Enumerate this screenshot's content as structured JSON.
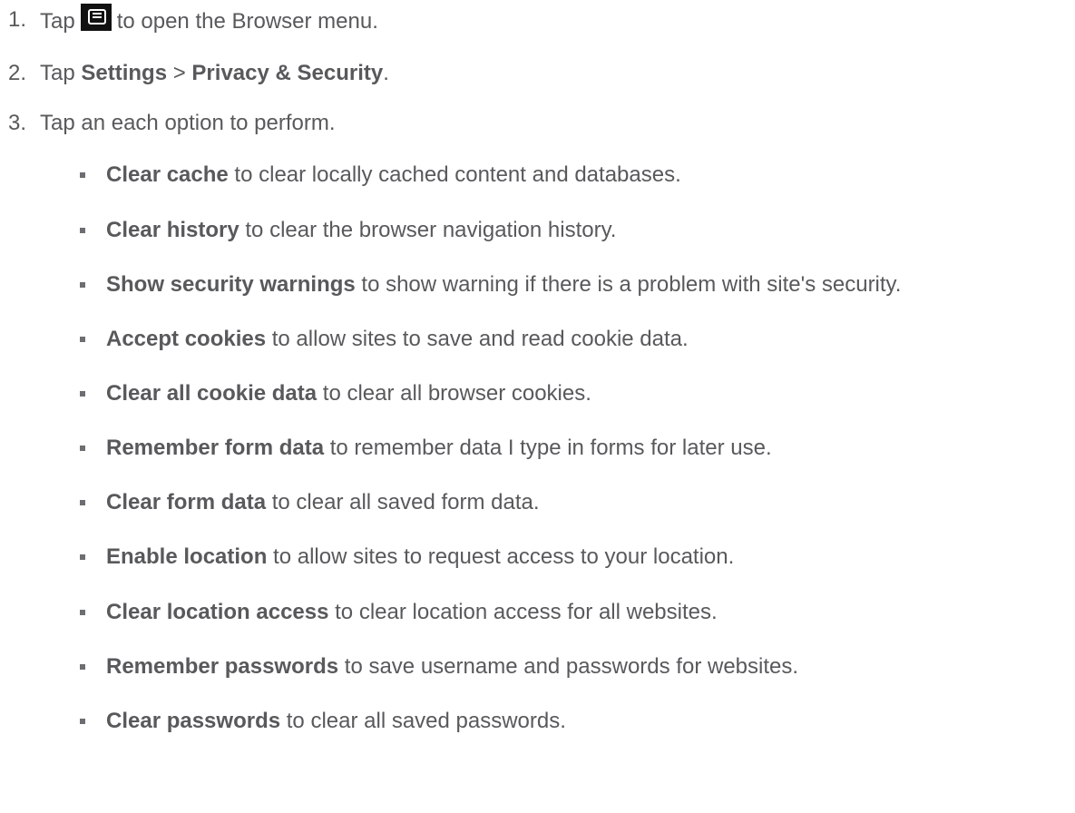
{
  "steps": [
    {
      "number": "1.",
      "before": "Tap",
      "icon": "menu-icon",
      "after": "to open the Browser menu."
    },
    {
      "number": "2.",
      "before": "Tap ",
      "bold1": "Settings",
      "mid": " > ",
      "bold2": "Privacy & Security",
      "after": "."
    },
    {
      "number": "3.",
      "text": "Tap an each option to perform."
    }
  ],
  "options": [
    {
      "term": "Clear cache",
      "desc": " to clear locally cached content and databases."
    },
    {
      "term": "Clear history",
      "desc": " to clear the browser navigation history."
    },
    {
      "term": "Show security warnings",
      "desc": " to show warning if there is a problem with site's security."
    },
    {
      "term": "Accept cookies",
      "desc": " to allow sites to save and read cookie data."
    },
    {
      "term": "Clear all cookie data",
      "desc": " to clear all browser cookies."
    },
    {
      "term": "Remember form data",
      "desc": " to remember data I type in forms for later use."
    },
    {
      "term": "Clear form data",
      "desc": " to clear all saved form data."
    },
    {
      "term": "Enable location",
      "desc": " to allow sites to request access to your location."
    },
    {
      "term": "Clear location access",
      "desc": " to clear location access for all websites."
    },
    {
      "term": "Remember passwords",
      "desc": " to save username and passwords for websites."
    },
    {
      "term": "Clear passwords",
      "desc": " to clear all saved passwords."
    }
  ]
}
